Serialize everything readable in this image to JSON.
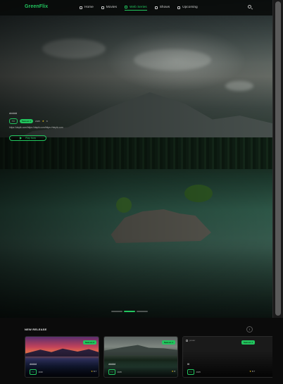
{
  "app": {
    "logo": "GreenFlix"
  },
  "nav": {
    "items": [
      {
        "label": "Home",
        "icon": "home-icon",
        "active": false
      },
      {
        "label": "Movies",
        "icon": "film-icon",
        "active": false
      },
      {
        "label": "Web Series",
        "icon": "tv-icon",
        "active": true
      },
      {
        "label": "Shows",
        "icon": "monitor-icon",
        "active": false
      },
      {
        "label": "Upcoming",
        "icon": "calendar-icon",
        "active": false
      }
    ],
    "search_icon": "search-icon"
  },
  "hero": {
    "title": "ddddd",
    "tag": "TV",
    "season": "Season 1",
    "year": "2025",
    "rating": "8",
    "description": "https://depik.com/https://depik.com/https://depik.com",
    "play_label": "Play Now"
  },
  "carousel": {
    "slides": 3,
    "active": 2
  },
  "new_release": {
    "title": "NEW RELEASE",
    "arrow": "›",
    "cards": [
      {
        "title": "ddddd",
        "tag": "TV",
        "year": "2026",
        "season": "Season 2",
        "rating": "8.7"
      },
      {
        "title": "ddddd",
        "tag": "TV",
        "year": "2025",
        "season": "Season 1",
        "rating": "8"
      },
      {
        "title": "ttt",
        "tag": "TV",
        "year": "2025",
        "season": "Season 1",
        "rating": "8.7",
        "image_alt": "poster"
      }
    ]
  },
  "colors": {
    "accent": "#22c55e",
    "star": "#facc15",
    "background": "#0b0b0b"
  }
}
